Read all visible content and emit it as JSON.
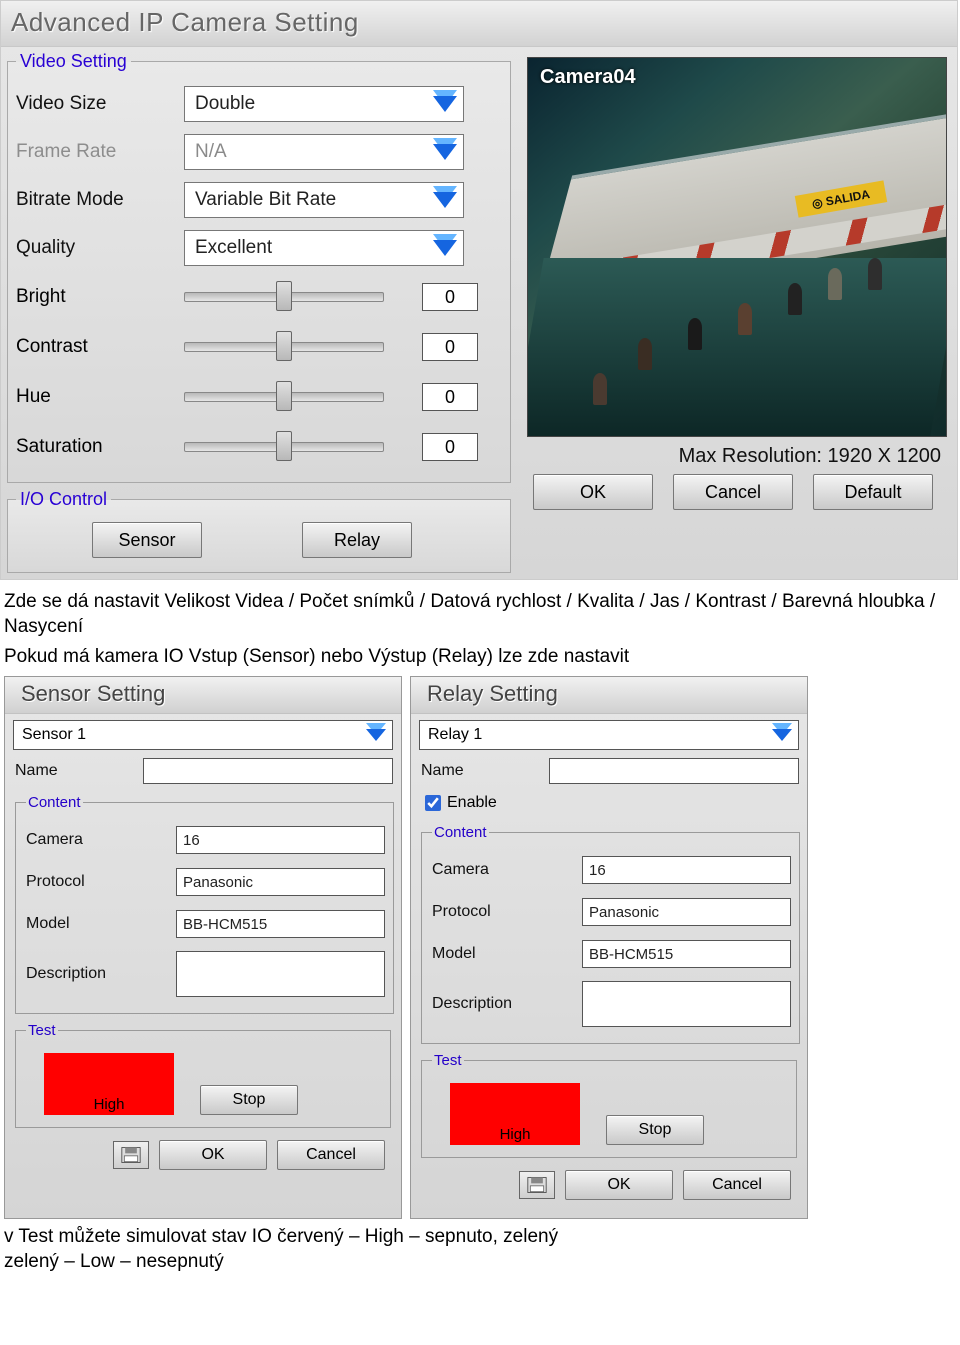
{
  "adv": {
    "title": "Advanced IP Camera Setting",
    "video_legend": "Video Setting",
    "labels": {
      "video_size": "Video Size",
      "frame_rate": "Frame Rate",
      "bitrate_mode": "Bitrate Mode",
      "quality": "Quality",
      "bright": "Bright",
      "contrast": "Contrast",
      "hue": "Hue",
      "saturation": "Saturation"
    },
    "values": {
      "video_size": "Double",
      "frame_rate": "N/A",
      "bitrate_mode": "Variable Bit Rate",
      "quality": "Excellent",
      "bright": "0",
      "contrast": "0",
      "hue": "0",
      "saturation": "0"
    },
    "io_legend": "I/O Control",
    "io_buttons": {
      "sensor": "Sensor",
      "relay": "Relay"
    },
    "camera_label": "Camera04",
    "salida_sign": "◎ SALIDA",
    "max_res": "Max Resolution: 1920 X 1200",
    "buttons": {
      "ok": "OK",
      "cancel": "Cancel",
      "default": "Default"
    }
  },
  "paragraph1": "Zde se dá nastavit Velikost Videa / Počet snímků / Datová rychlost / Kvalita / Jas / Kontrast / Barevná hloubka / Nasycení",
  "paragraph2": "Pokud má kamera IO Vstup (Sensor) nebo Výstup (Relay) lze zde nastavit",
  "sensor": {
    "title": "Sensor Setting",
    "selected": "Sensor 1",
    "name_label": "Name",
    "name_value": "",
    "content_legend": "Content",
    "camera_label": "Camera",
    "camera_value": "16",
    "protocol_label": "Protocol",
    "protocol_value": "Panasonic",
    "model_label": "Model",
    "model_value": "BB-HCM515",
    "description_label": "Description",
    "description_value": "",
    "test_legend": "Test",
    "test_state": "High",
    "stop": "Stop",
    "ok": "OK",
    "cancel": "Cancel"
  },
  "relay": {
    "title": "Relay Setting",
    "selected": "Relay 1",
    "name_label": "Name",
    "name_value": "",
    "enable_label": "Enable",
    "enable_checked": true,
    "content_legend": "Content",
    "camera_label": "Camera",
    "camera_value": "16",
    "protocol_label": "Protocol",
    "protocol_value": "Panasonic",
    "model_label": "Model",
    "model_value": "BB-HCM515",
    "description_label": "Description",
    "description_value": "",
    "test_legend": "Test",
    "test_state": "High",
    "stop": "Stop",
    "ok": "OK",
    "cancel": "Cancel"
  },
  "bottom1": "v Test můžete simulovat stav IO červený – High – sepnuto, zelený",
  "bottom2": "zelený – Low – nesepnutý"
}
